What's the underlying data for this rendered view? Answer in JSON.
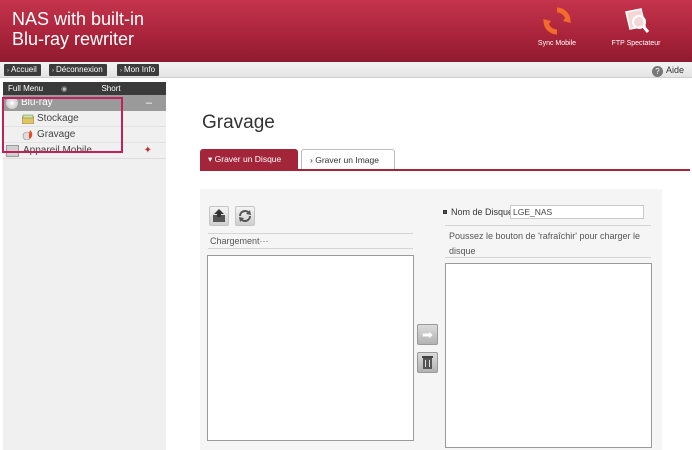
{
  "header": {
    "title_line1": "NAS with built-in",
    "title_line2": "Blu-ray rewriter",
    "sync_label": "Sync Mobile",
    "ftp_label": "FTP Spectateur"
  },
  "toolbar": {
    "home_label": "Accueil",
    "logout_label": "Déconnexion",
    "myinfo_label": "Mon Info",
    "help_label": "Aide"
  },
  "sidebar": {
    "full_menu": "Full Menu",
    "short_menu": "Short Menu",
    "bluray_label": "Blu-ray",
    "items": [
      {
        "label": "Stockage"
      },
      {
        "label": "Gravage"
      }
    ],
    "mobile_label": "Appareil Mobile"
  },
  "main": {
    "page_title": "Gravage",
    "tabs": [
      {
        "label": "Graver un Disque",
        "active": true
      },
      {
        "label": "Graver un Image",
        "active": false
      }
    ],
    "loading_label": "Chargement···",
    "disc_name_label": "Nom de Disque",
    "disc_name_value": "LGE_NAS",
    "hint_text": "Poussez le bouton de 'rafraîchir' pour charger le disque"
  },
  "colors": {
    "brand": "#a3253a",
    "highlight": "#c2205a",
    "sync_icon": "#e8622a"
  }
}
